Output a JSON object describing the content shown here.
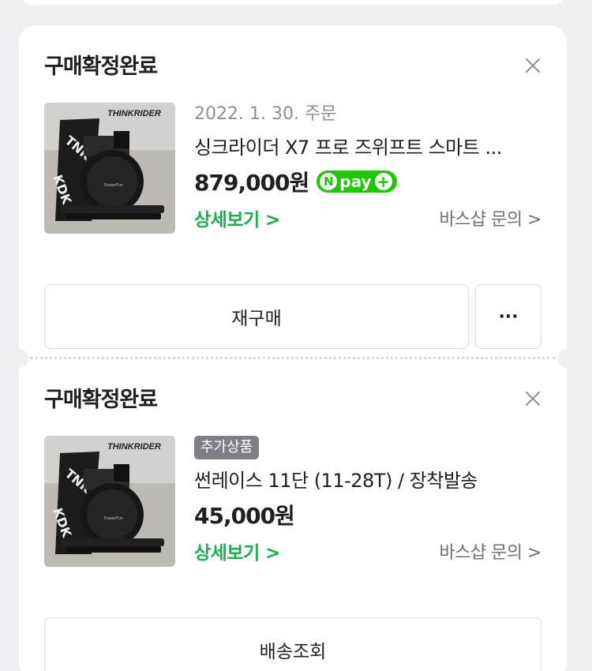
{
  "orders": [
    {
      "status_title": "구매확정완료",
      "date_label": "2022. 1. 30. 주문",
      "product_name": "싱크라이더 X7 프로 즈위프트 스마트 ...",
      "price": "879,000원",
      "npay_label": "pay",
      "detail_link": "상세보기 >",
      "inquiry_link": "바스샵 문의 >",
      "primary_button": "재구매",
      "more_button": "···",
      "thumb_brand": "THINKRIDER",
      "thumb_model": "PowerFun"
    },
    {
      "status_title": "구매확정완료",
      "tag": "추가상품",
      "product_name": "썬레이스 11단 (11-28T) / 장착발송",
      "price": "45,000원",
      "detail_link": "상세보기 >",
      "inquiry_link": "바스샵 문의 >",
      "primary_button": "배송조회",
      "thumb_brand": "THINKRIDER",
      "thumb_model": "PowerFun"
    }
  ],
  "colors": {
    "accent_green": "#13b24a",
    "npay_green": "#1ec800",
    "background": "#eef0f3"
  }
}
